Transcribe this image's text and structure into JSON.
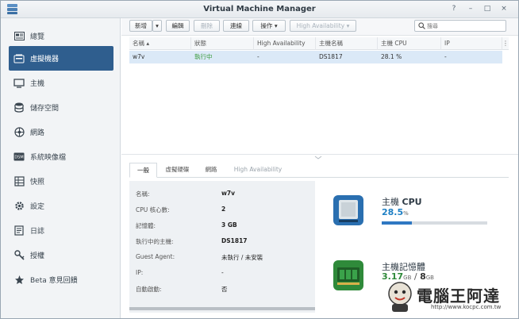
{
  "window": {
    "title": "Virtual Machine Manager",
    "controls": [
      "?",
      "–",
      "□",
      "×"
    ]
  },
  "sidebar": {
    "items": [
      {
        "label": "總覽",
        "icon": "overview-icon",
        "active": false
      },
      {
        "label": "虛擬機器",
        "icon": "vm-icon",
        "active": true
      },
      {
        "label": "主機",
        "icon": "host-icon",
        "active": false
      },
      {
        "label": "儲存空間",
        "icon": "storage-icon",
        "active": false
      },
      {
        "label": "網路",
        "icon": "network-icon",
        "active": false
      },
      {
        "label": "系統映像檔",
        "icon": "image-icon",
        "active": false
      },
      {
        "label": "快照",
        "icon": "snapshot-icon",
        "active": false
      },
      {
        "label": "設定",
        "icon": "gear-icon",
        "active": false
      },
      {
        "label": "日誌",
        "icon": "log-icon",
        "active": false
      },
      {
        "label": "授權",
        "icon": "key-icon",
        "active": false
      },
      {
        "label": "Beta 意見回饋",
        "icon": "feedback-icon",
        "active": false
      }
    ]
  },
  "toolbar": {
    "new_label": "新增",
    "edit_label": "編輯",
    "delete_label": "刪除",
    "connect_label": "連線",
    "action_label": "操作",
    "ha_label": "High Availability",
    "search_placeholder": "搜尋"
  },
  "table": {
    "headers": [
      "名稱",
      "狀態",
      "High Availability",
      "主機名稱",
      "主機 CPU",
      "IP"
    ],
    "rows": [
      {
        "name": "w7v",
        "status": "執行中",
        "ha": "-",
        "host": "DS1817",
        "cpu": "28.1 %",
        "ip": "-"
      }
    ]
  },
  "detail": {
    "tabs": [
      "一般",
      "虛擬硬碟",
      "網路",
      "High Availability"
    ],
    "fields": [
      {
        "label": "名稱:",
        "value": "w7v"
      },
      {
        "label": "CPU 核心數:",
        "value": "2"
      },
      {
        "label": "記憶體:",
        "value": "3 GB"
      },
      {
        "label": "執行中的主機:",
        "value": "DS1817"
      },
      {
        "label": "Guest Agent:",
        "value": "未執行 / 未安裝"
      },
      {
        "label": "IP:",
        "value": "-"
      },
      {
        "label": "自動啟動:",
        "value": "否"
      }
    ]
  },
  "stats": {
    "cpu_title_prefix": "主機 ",
    "cpu_title_bold": "CPU",
    "cpu_value": "28.5",
    "cpu_unit": "%",
    "cpu_percent": 28.5,
    "mem_title": "主機記憶體",
    "mem_used": "3.17",
    "mem_used_unit": "GB",
    "mem_sep": " / ",
    "mem_total": "8",
    "mem_total_unit": "GB"
  },
  "watermark": {
    "text": "電腦王阿達",
    "url": "http://www.kocpc.com.tw"
  },
  "colors": {
    "accent": "#2f5e8e",
    "running": "#3a9a3a",
    "selected_row": "#dbe9f7",
    "bar_fill": "#2f78c2"
  }
}
